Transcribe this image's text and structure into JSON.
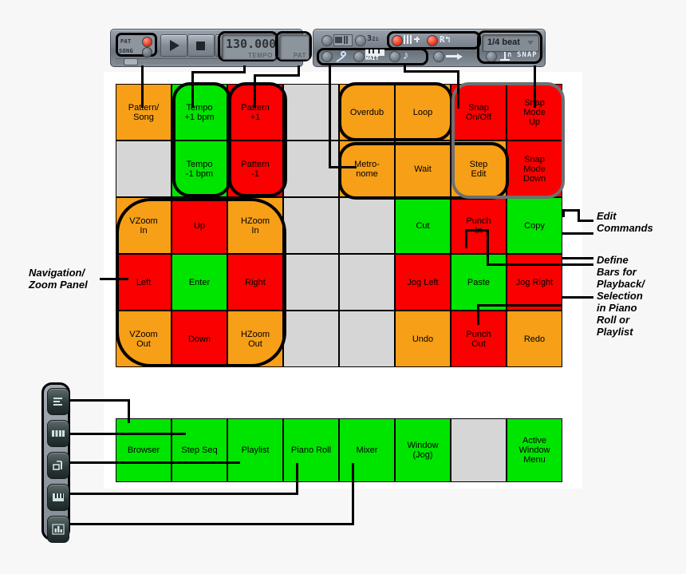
{
  "transport_left": {
    "pat_label": "PAT",
    "song_label": "SONG",
    "play_icon": "play-icon",
    "stop_icon": "stop-icon",
    "record_icon": "record-icon",
    "tempo_value": "130.000",
    "tempo_label": "TEMPO",
    "pat_display_value": "",
    "pat_display_label": "PAT"
  },
  "transport_right": {
    "row1": [
      {
        "name": "typing-keyboard-toggle",
        "icon": "keyboard-icon",
        "led": "off"
      },
      {
        "name": "multilink-toggle",
        "icon": "321-icon",
        "led": "off",
        "text": "321"
      },
      {
        "name": "overdub-toggle",
        "icon": "blend-icon",
        "led": "on"
      },
      {
        "name": "record-toggle",
        "icon": "loop-record-icon",
        "led": "on",
        "text": "R"
      },
      {
        "name": "countdown-toggle",
        "icon": "metronome-icon",
        "led": "on"
      }
    ],
    "row2": [
      {
        "name": "metronome-toggle",
        "icon": "wrench-icon",
        "led": "off"
      },
      {
        "name": "wait-toggle",
        "icon": "wait-keys-icon",
        "led": "off",
        "text": "WAIT"
      },
      {
        "name": "step-edit-toggle",
        "icon": "note-icon",
        "led": "off"
      },
      {
        "name": "loop-toggle",
        "icon": "arrow-icon",
        "led": "off"
      },
      {
        "name": "snap-anchor-toggle",
        "icon": "anchor-icon",
        "led": "off"
      }
    ],
    "snap_value": "1/4 beat",
    "snap_label": "SNAP",
    "snap_icon": "magnet-icon"
  },
  "grid": {
    "columns": 8,
    "rows": 5,
    "cells": [
      {
        "r": 0,
        "c": 0,
        "label": "Pattern/\nSong",
        "color": "orange"
      },
      {
        "r": 0,
        "c": 1,
        "label": "Tempo\n+1 bpm",
        "color": "green"
      },
      {
        "r": 0,
        "c": 2,
        "label": "Pattern\n+1",
        "color": "red"
      },
      {
        "r": 0,
        "c": 3,
        "label": "",
        "color": "grey"
      },
      {
        "r": 0,
        "c": 4,
        "label": "Overdub",
        "color": "orange"
      },
      {
        "r": 0,
        "c": 5,
        "label": "Loop",
        "color": "orange"
      },
      {
        "r": 0,
        "c": 6,
        "label": "Snap\nOn/Off",
        "color": "red"
      },
      {
        "r": 0,
        "c": 7,
        "label": "Snap\nMode\nUp",
        "color": "red"
      },
      {
        "r": 1,
        "c": 0,
        "label": "",
        "color": "grey"
      },
      {
        "r": 1,
        "c": 1,
        "label": "Tempo\n-1 bpm",
        "color": "green"
      },
      {
        "r": 1,
        "c": 2,
        "label": "Pattern\n-1",
        "color": "red"
      },
      {
        "r": 1,
        "c": 3,
        "label": "",
        "color": "grey"
      },
      {
        "r": 1,
        "c": 4,
        "label": "Metro-\nnome",
        "color": "orange"
      },
      {
        "r": 1,
        "c": 5,
        "label": "Wait",
        "color": "orange"
      },
      {
        "r": 1,
        "c": 6,
        "label": "Step\nEdit",
        "color": "orange"
      },
      {
        "r": 1,
        "c": 7,
        "label": "Snap\nMode\nDown",
        "color": "red"
      },
      {
        "r": 2,
        "c": 0,
        "label": "VZoom\nIn",
        "color": "orange"
      },
      {
        "r": 2,
        "c": 1,
        "label": "Up",
        "color": "red"
      },
      {
        "r": 2,
        "c": 2,
        "label": "HZoom\nIn",
        "color": "orange"
      },
      {
        "r": 2,
        "c": 3,
        "label": "",
        "color": "grey"
      },
      {
        "r": 2,
        "c": 4,
        "label": "",
        "color": "grey"
      },
      {
        "r": 2,
        "c": 5,
        "label": "Cut",
        "color": "green"
      },
      {
        "r": 2,
        "c": 6,
        "label": "Punch\nIn",
        "color": "red"
      },
      {
        "r": 2,
        "c": 7,
        "label": "Copy",
        "color": "green"
      },
      {
        "r": 3,
        "c": 0,
        "label": "Left",
        "color": "red"
      },
      {
        "r": 3,
        "c": 1,
        "label": "Enter",
        "color": "green"
      },
      {
        "r": 3,
        "c": 2,
        "label": "Right",
        "color": "red"
      },
      {
        "r": 3,
        "c": 3,
        "label": "",
        "color": "grey"
      },
      {
        "r": 3,
        "c": 4,
        "label": "",
        "color": "grey"
      },
      {
        "r": 3,
        "c": 5,
        "label": "Jog Left",
        "color": "red"
      },
      {
        "r": 3,
        "c": 6,
        "label": "Paste",
        "color": "green"
      },
      {
        "r": 3,
        "c": 7,
        "label": "Jog Right",
        "color": "red"
      },
      {
        "r": 4,
        "c": 0,
        "label": "VZoom\nOut",
        "color": "orange"
      },
      {
        "r": 4,
        "c": 1,
        "label": "Down",
        "color": "red"
      },
      {
        "r": 4,
        "c": 2,
        "label": "HZoom\nOut",
        "color": "orange"
      },
      {
        "r": 4,
        "c": 3,
        "label": "",
        "color": "grey"
      },
      {
        "r": 4,
        "c": 4,
        "label": "",
        "color": "grey"
      },
      {
        "r": 4,
        "c": 5,
        "label": "Undo",
        "color": "orange"
      },
      {
        "r": 4,
        "c": 6,
        "label": "Punch\nOut",
        "color": "red"
      },
      {
        "r": 4,
        "c": 7,
        "label": "Redo",
        "color": "orange"
      }
    ]
  },
  "bottom_row": {
    "cells": [
      {
        "label": "Browser",
        "color": "green"
      },
      {
        "label": "Step Seq",
        "color": "green"
      },
      {
        "label": "Playlist",
        "color": "green"
      },
      {
        "label": "Piano Roll",
        "color": "green"
      },
      {
        "label": "Mixer",
        "color": "green"
      },
      {
        "label": "Window\n(Jog)",
        "color": "green"
      },
      {
        "label": "",
        "color": "grey"
      },
      {
        "label": "Active\nWindow\nMenu",
        "color": "green"
      }
    ]
  },
  "sidebar": {
    "items": [
      {
        "name": "sidebar-item-browser",
        "icon": "browser-list-icon"
      },
      {
        "name": "sidebar-item-step-seq",
        "icon": "step-sequencer-icon"
      },
      {
        "name": "sidebar-item-playlist",
        "icon": "playlist-icon"
      },
      {
        "name": "sidebar-item-piano-roll",
        "icon": "piano-roll-icon"
      },
      {
        "name": "sidebar-item-mixer",
        "icon": "mixer-icon"
      }
    ]
  },
  "annotations": {
    "navigation": "Navigation/\nZoom Panel",
    "edit_commands": "Edit\nCommands",
    "define_bars": "Define\nBars for\nPlayback/\nSelection\nin Piano\nRoll or\nPlaylist"
  },
  "colors": {
    "orange": "#f79f17",
    "green": "#00e500",
    "red": "#fa0000",
    "grey": "#d6d6d6"
  }
}
